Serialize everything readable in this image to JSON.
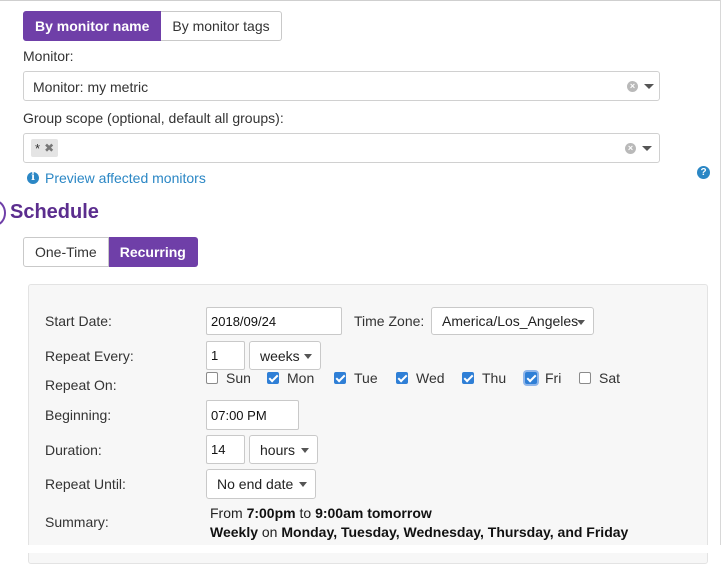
{
  "monitor_mode": {
    "by_name_label": "By monitor name",
    "by_tags_label": "By monitor tags"
  },
  "monitor": {
    "label": "Monitor:",
    "value": "Monitor: my metric"
  },
  "group_scope": {
    "label": "Group scope (optional, default all groups):",
    "tag": "*"
  },
  "preview": {
    "label": "Preview affected monitors"
  },
  "schedule": {
    "title": "Schedule",
    "one_time_label": "One-Time",
    "recurring_label": "Recurring",
    "start_date_label": "Start Date:",
    "start_date_value": "2018/09/24",
    "time_zone_label": "Time Zone:",
    "time_zone_value": "America/Los_Angeles",
    "repeat_every_label": "Repeat Every:",
    "repeat_every_value": "1",
    "repeat_unit": "weeks",
    "repeat_on_label": "Repeat On:",
    "days": [
      {
        "label": "Sun",
        "checked": false
      },
      {
        "label": "Mon",
        "checked": true
      },
      {
        "label": "Tue",
        "checked": true
      },
      {
        "label": "Wed",
        "checked": true
      },
      {
        "label": "Thu",
        "checked": true
      },
      {
        "label": "Fri",
        "checked": true
      },
      {
        "label": "Sat",
        "checked": false
      }
    ],
    "beginning_label": "Beginning:",
    "beginning_value": "07:00 PM",
    "duration_label": "Duration:",
    "duration_value": "14",
    "duration_unit": "hours",
    "repeat_until_label": "Repeat Until:",
    "repeat_until_value": "No end date",
    "summary_label": "Summary:",
    "summary": {
      "from": "From",
      "start_time": "7:00pm",
      "to": "to",
      "end_time": "9:00am tomorrow",
      "frequency": "Weekly",
      "on": "on",
      "days_text": "Monday, Tuesday, Wednesday, Thursday, and Friday"
    }
  }
}
